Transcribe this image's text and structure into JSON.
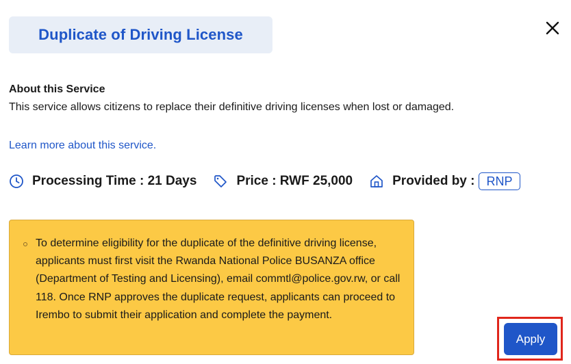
{
  "dialog": {
    "title": "Duplicate of Driving License",
    "close_icon": "close-icon"
  },
  "about": {
    "heading": "About this Service",
    "description": "This service allows citizens to replace their definitive driving licenses when lost or damaged.",
    "learn_more": "Learn more about this service."
  },
  "meta": {
    "processing_time": "Processing Time : 21 Days",
    "price": "Price : RWF 25,000",
    "provided_by_label": "Provided by :",
    "provider": "RNP",
    "icons": [
      "clock-icon",
      "price-tag-icon",
      "building-icon"
    ]
  },
  "notice": {
    "text": "To determine eligibility for the duplicate of the definitive driving license, applicants must first visit the Rwanda National Police BUSANZA office (Department of Testing and Licensing), email commtl@police.gov.rw, or call 118. Once RNP approves the duplicate request, applicants can proceed to Irembo to submit their application and complete the payment."
  },
  "actions": {
    "apply_label": "Apply"
  },
  "colors": {
    "accent": "#1f56c8",
    "notice_bg": "#fcc945",
    "highlight": "#e0261b",
    "title_chip_bg": "#e8eef7"
  }
}
